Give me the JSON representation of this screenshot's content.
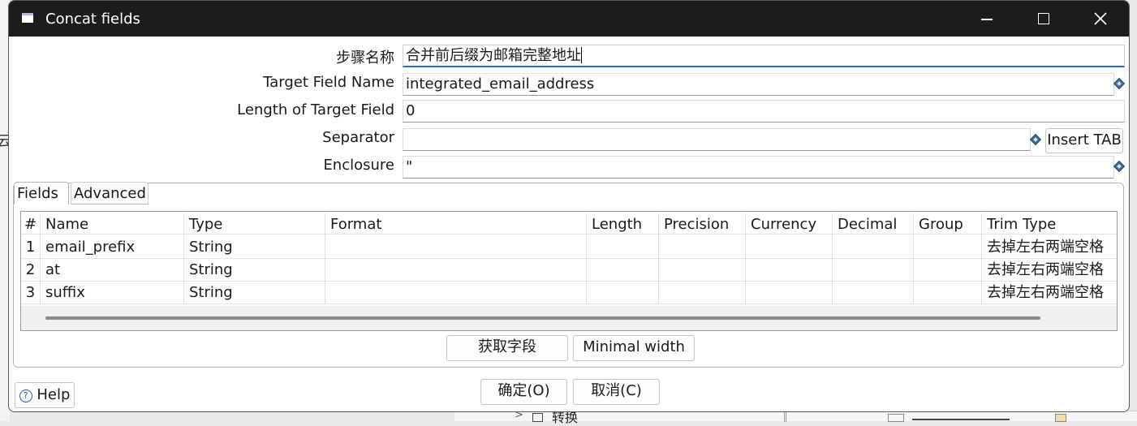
{
  "window": {
    "title": "Concat fields"
  },
  "form": {
    "step_name": {
      "label": "步骤名称",
      "value": "合并前后缀为邮箱完整地址"
    },
    "target_field_name": {
      "label": "Target Field Name",
      "value": "integrated_email_address"
    },
    "target_length": {
      "label": "Length of Target Field",
      "value": "0"
    },
    "separator": {
      "label": "Separator",
      "value": ""
    },
    "insert_tab_button": "Insert TAB",
    "enclosure": {
      "label": "Enclosure",
      "value": "\""
    }
  },
  "tabs": [
    {
      "label": "Fields",
      "selected": true
    },
    {
      "label": "Advanced",
      "selected": false
    }
  ],
  "table": {
    "columns": [
      "#",
      "Name",
      "Type",
      "Format",
      "Length",
      "Precision",
      "Currency",
      "Decimal",
      "Group",
      "Trim Type"
    ],
    "rows": [
      [
        "1",
        "email_prefix",
        "String",
        "",
        "",
        "",
        "",
        "",
        "",
        "去掉左右两端空格"
      ],
      [
        "2",
        "at",
        "String",
        "",
        "",
        "",
        "",
        "",
        "",
        "去掉左右两端空格"
      ],
      [
        "3",
        "suffix",
        "String",
        "",
        "",
        "",
        "",
        "",
        "",
        "去掉左右两端空格"
      ]
    ]
  },
  "buttons": {
    "get_fields": "获取字段",
    "minimal_width": "Minimal width",
    "ok": "确定(O)",
    "cancel": "取消(C)",
    "help": "Help"
  },
  "background": {
    "left_glyph": "云",
    "bottom_text": "转换"
  },
  "icons": {
    "variable": "variable-diamond-icon",
    "help": "help-circle-icon",
    "app": "window-app-icon"
  }
}
